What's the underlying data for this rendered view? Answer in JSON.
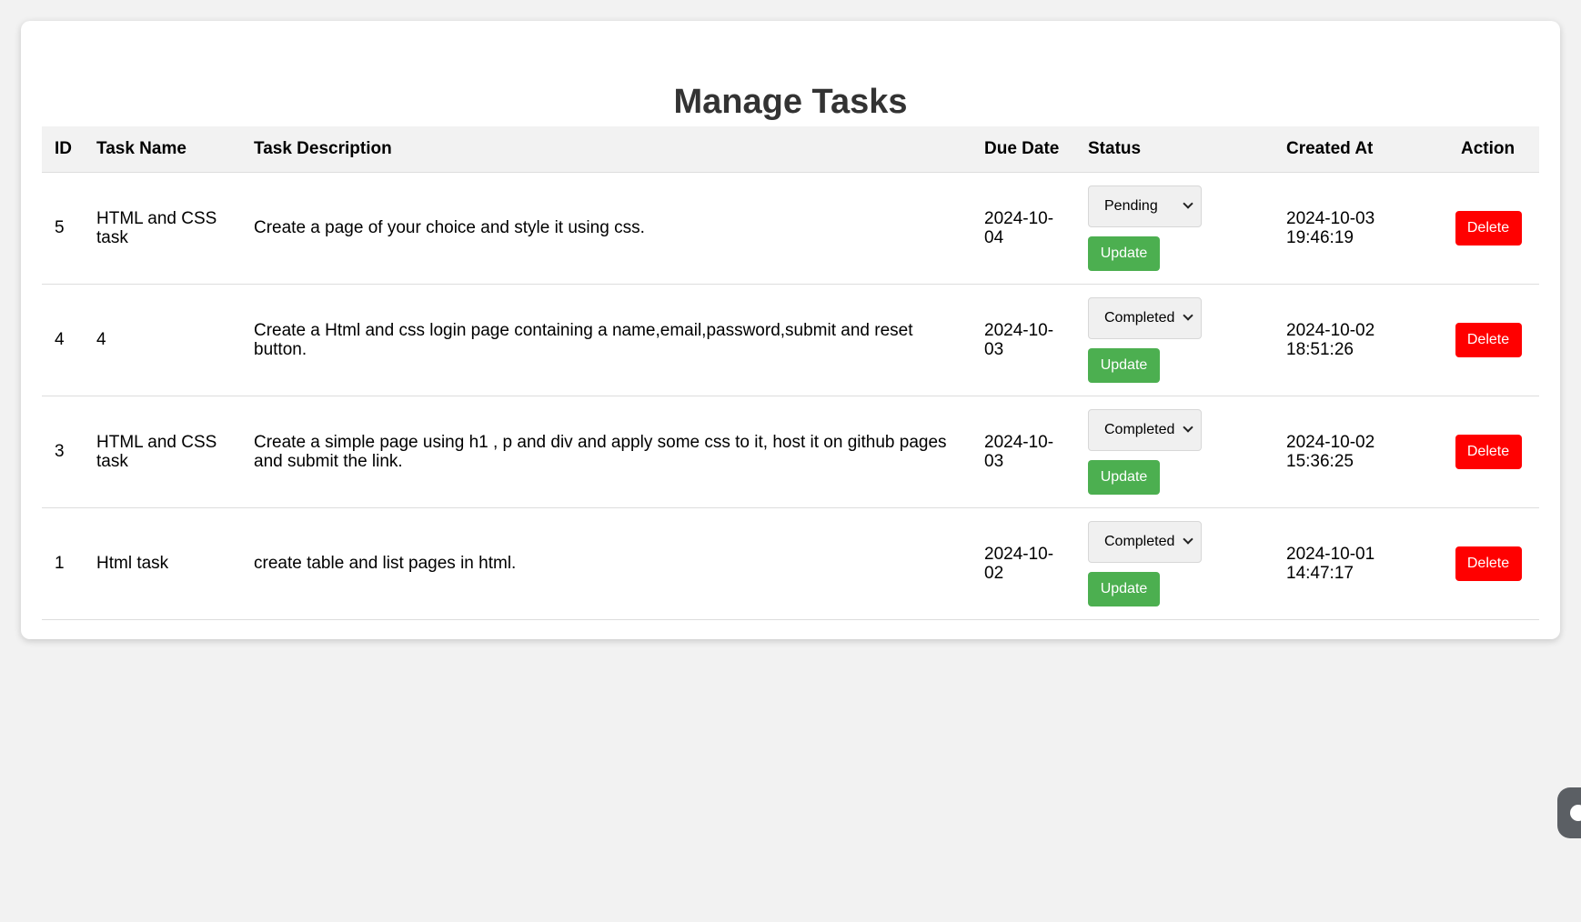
{
  "page": {
    "title": "Manage Tasks"
  },
  "table": {
    "headers": {
      "id": "ID",
      "name": "Task Name",
      "description": "Task Description",
      "due": "Due Date",
      "status": "Status",
      "created": "Created At",
      "action": "Action"
    },
    "rows": [
      {
        "id": "5",
        "name": "HTML and CSS task",
        "description": "Create a page of your choice and style it using css.",
        "due": "2024-10-04",
        "status": "Pending",
        "created": "2024-10-03 19:46:19",
        "update_label": "Update",
        "delete_label": "Delete"
      },
      {
        "id": "4",
        "name": "4",
        "description": "Create a Html and css login page containing a name,email,password,submit and reset button.",
        "due": "2024-10-03",
        "status": "Completed",
        "created": "2024-10-02 18:51:26",
        "update_label": "Update",
        "delete_label": "Delete"
      },
      {
        "id": "3",
        "name": "HTML and CSS task",
        "description": "Create a simple page using h1 , p and div and apply some css to it, host it on github pages and submit the link.",
        "due": "2024-10-03",
        "status": "Completed",
        "created": "2024-10-02 15:36:25",
        "update_label": "Update",
        "delete_label": "Delete"
      },
      {
        "id": "1",
        "name": "Html task",
        "description": "create table and list pages in html.",
        "due": "2024-10-02",
        "status": "Completed",
        "created": "2024-10-01 14:47:17",
        "update_label": "Update",
        "delete_label": "Delete"
      }
    ]
  },
  "colors": {
    "update_button": "#4caf50",
    "delete_button": "#ff0000",
    "header_bg": "#f2f2f2",
    "page_bg": "#f2f2f2"
  },
  "icons": {
    "select_arrow": "chevron-down-icon",
    "side_widget": "chat-widget-icon"
  }
}
